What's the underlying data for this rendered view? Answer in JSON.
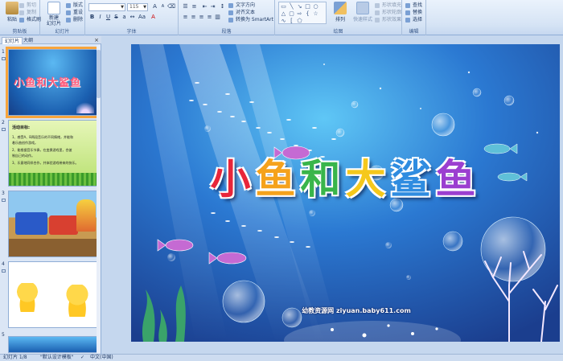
{
  "ribbon": {
    "clipboard": {
      "label": "剪贴板",
      "paste": "粘贴",
      "cut": "剪切",
      "copy": "复制",
      "format_painter": "格式刷"
    },
    "slides": {
      "label": "幻灯片",
      "new_slide": "新建\n幻灯片",
      "layout": "版式",
      "reset": "重设",
      "delete": "删除"
    },
    "font": {
      "label": "字体",
      "font_name": "",
      "font_size": "115"
    },
    "paragraph": {
      "label": "段落",
      "text_direction": "文字方向",
      "align_text": "对齐文本",
      "smartart": "转换为 SmartArt"
    },
    "drawing": {
      "label": "绘图",
      "arrange": "排列",
      "quick_styles": "快速样式",
      "shape_fill": "形状填充",
      "shape_outline": "形状轮廓",
      "shape_effects": "形状效果"
    },
    "editing": {
      "label": "编辑",
      "find": "查找",
      "replace": "替换",
      "select": "选择"
    }
  },
  "panel": {
    "tab_slides": "幻灯片",
    "tab_outline": "大纲",
    "close": "×"
  },
  "thumbnails": [
    {
      "number": "1",
      "title": "小鱼和大鲨鱼"
    },
    {
      "number": "2",
      "heading": "活动目标:",
      "lines": [
        "1、感受A、B两段音乐的不同情绪，并能和",
        "着乐曲创作游戏。",
        "2、能根据音乐节奏，在变换游戏里，合彼",
        "制自己的动作。",
        "3、乐意地同伴合作，并体验游戏带来的快乐。"
      ]
    },
    {
      "number": "3"
    },
    {
      "number": "4"
    },
    {
      "number": "5"
    }
  ],
  "slide": {
    "title": "小鱼和大鲨鱼",
    "watermark": "幼教资源网 ziyuan.baby611.com",
    "watermark_sub": ""
  },
  "status": {
    "slide_info": "幻灯片 1/8",
    "theme": "\"默认设计模板\"",
    "language": "中文(中国)"
  },
  "colors": {
    "title_letters": [
      "#e8263a",
      "#f5a21c",
      "#39b54a",
      "#f5c81c",
      "#2f8ce0",
      "#9b3fd0"
    ]
  }
}
